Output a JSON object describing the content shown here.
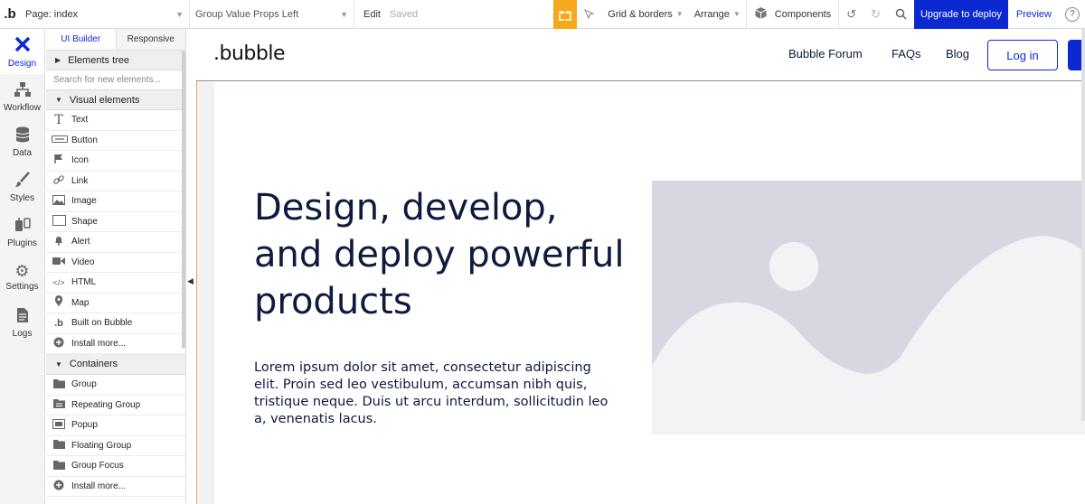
{
  "topbar": {
    "logo": ".b",
    "page_select": "Page: index",
    "element_select": "Group Value Props Left",
    "edit_label": "Edit",
    "saved_label": "Saved",
    "grid_label": "Grid & borders",
    "arrange_label": "Arrange",
    "components_label": "Components",
    "upgrade_label": "Upgrade to deploy",
    "preview_label": "Preview",
    "help_label": "?"
  },
  "rail": {
    "items": [
      {
        "label": "Design",
        "icon": "design-icon"
      },
      {
        "label": "Workflow",
        "icon": "workflow-icon"
      },
      {
        "label": "Data",
        "icon": "data-icon"
      },
      {
        "label": "Styles",
        "icon": "styles-icon"
      },
      {
        "label": "Plugins",
        "icon": "plugins-icon"
      },
      {
        "label": "Settings",
        "icon": "settings-icon"
      },
      {
        "label": "Logs",
        "icon": "logs-icon"
      }
    ]
  },
  "panel": {
    "tabs": [
      "UI Builder",
      "Responsive"
    ],
    "elements_tree": "Elements tree",
    "search_placeholder": "Search for new elements...",
    "visual_elements": "Visual elements",
    "visual_items": [
      "Text",
      "Button",
      "Icon",
      "Link",
      "Image",
      "Shape",
      "Alert",
      "Video",
      "HTML",
      "Map",
      "Built on Bubble",
      "Install more..."
    ],
    "containers": "Containers",
    "container_items": [
      "Group",
      "Repeating Group",
      "Popup",
      "Floating Group",
      "Group Focus",
      "Install more..."
    ]
  },
  "canvas": {
    "brand": ".bubble",
    "nav": {
      "forum": "Bubble Forum",
      "faqs": "FAQs",
      "blog": "Blog",
      "login": "Log in"
    },
    "hero_title": "Design, develop, and deploy powerful products",
    "hero_body": "Lorem ipsum dolor sit amet, consectetur adipiscing elit. Proin sed leo vestibulum, accumsan nibh quis, tristique neque. Duis ut arcu interdum, sollicitudin leo a, venenatis lacus."
  },
  "colors": {
    "accent": "#0c29d1",
    "gift": "#f7a81b",
    "hero_text": "#0e1a3e",
    "placeholder_bg": "#d7d7e2",
    "placeholder_fg": "#f3f3f6"
  }
}
